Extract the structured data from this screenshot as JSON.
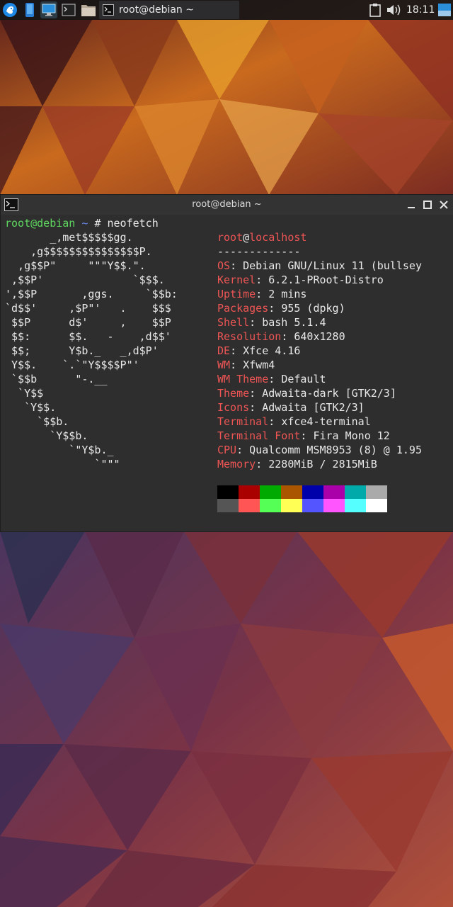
{
  "panel": {
    "task_title": "root@debian ~",
    "clock": "18:11",
    "launchers": [
      "whisker-menu-icon",
      "phone-icon",
      "desktop-icon",
      "terminal-icon",
      "folder-icon"
    ]
  },
  "terminal": {
    "title": "root@debian ~",
    "prompt_user": "root@debian",
    "prompt_path": "~",
    "prompt_symbol": "#",
    "command": "neofetch",
    "ascii_art": [
      "       _,met$$$$$gg.",
      "    ,g$$$$$$$$$$$$$$$P.",
      "  ,g$$P\"     \"\"\"Y$$.\".",
      " ,$$P'              `$$$.",
      "',$$P       ,ggs.     `$$b:",
      "`d$$'     ,$P\"'   .    $$$",
      " $$P      d$'     ,    $$P",
      " $$:      $$.   -    ,d$$'",
      " $$;      Y$b._   _,d$P'",
      " Y$$.    `.`\"Y$$$$P\"'",
      " `$$b      \"-.__",
      "  `Y$$",
      "   `Y$$.",
      "     `$$b.",
      "       `Y$$b.",
      "          `\"Y$b._",
      "              `\"\"\""
    ],
    "header_user": "root",
    "header_at": "@",
    "header_host": "localhost",
    "separator": "-------------",
    "info": [
      {
        "key": "OS",
        "value": "Debian GNU/Linux 11 (bullsey"
      },
      {
        "key": "Kernel",
        "value": "6.2.1-PRoot-Distro"
      },
      {
        "key": "Uptime",
        "value": "2 mins"
      },
      {
        "key": "Packages",
        "value": "955 (dpkg)"
      },
      {
        "key": "Shell",
        "value": "bash 5.1.4"
      },
      {
        "key": "Resolution",
        "value": "640x1280"
      },
      {
        "key": "DE",
        "value": "Xfce 4.16"
      },
      {
        "key": "WM",
        "value": "Xfwm4"
      },
      {
        "key": "WM Theme",
        "value": "Default"
      },
      {
        "key": "Theme",
        "value": "Adwaita-dark [GTK2/3]"
      },
      {
        "key": "Icons",
        "value": "Adwaita [GTK2/3]"
      },
      {
        "key": "Terminal",
        "value": "xfce4-terminal"
      },
      {
        "key": "Terminal Font",
        "value": "Fira Mono 12"
      },
      {
        "key": "CPU",
        "value": "Qualcomm MSM8953 (8) @ 1.95"
      },
      {
        "key": "Memory",
        "value": "2280MiB / 2815MiB"
      }
    ],
    "palette_top": [
      "#000000",
      "#aa0000",
      "#00aa00",
      "#aa5500",
      "#0000aa",
      "#aa00aa",
      "#00aaaa",
      "#aaaaaa"
    ],
    "palette_bottom": [
      "#555555",
      "#ff5555",
      "#55ff55",
      "#ffff55",
      "#5555ff",
      "#ff55ff",
      "#55ffff",
      "#ffffff"
    ]
  },
  "colors": {
    "accent_red": "#ee5555",
    "prompt_green": "#5fd75f",
    "prompt_blue": "#6a8cf0",
    "terminal_bg": "#2e2e2e"
  }
}
